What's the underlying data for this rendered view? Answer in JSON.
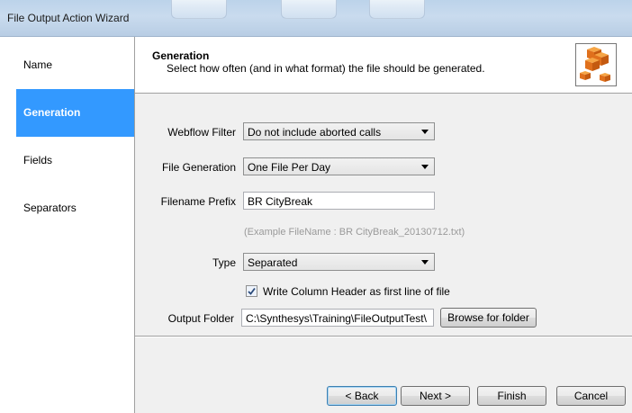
{
  "window": {
    "title": "File Output Action Wizard"
  },
  "sidebar": {
    "items": [
      {
        "label": "Name"
      },
      {
        "label": "Generation",
        "selected": true
      },
      {
        "label": "Fields"
      },
      {
        "label": "Separators"
      }
    ]
  },
  "header": {
    "title": "Generation",
    "subtitle": "Select how often (and in what format) the file should be generated.",
    "icon": "cubes-icon"
  },
  "form": {
    "webflow_filter": {
      "label": "Webflow Filter",
      "value": "Do not include aborted calls"
    },
    "file_generation": {
      "label": "File Generation",
      "value": "One File Per Day"
    },
    "filename_prefix": {
      "label": "Filename Prefix",
      "value": "BR CityBreak"
    },
    "example": "(Example FileName : BR CityBreak_20130712.txt)",
    "type": {
      "label": "Type",
      "value": "Separated"
    },
    "write_header": {
      "label": "Write Column Header as first line of file",
      "checked": true
    },
    "output_folder": {
      "label": "Output Folder",
      "value": "C:\\Synthesys\\Training\\FileOutputTest\\"
    },
    "browse_label": "Browse for folder"
  },
  "buttons": {
    "back": "< Back",
    "next": "Next >",
    "finish": "Finish",
    "cancel": "Cancel"
  },
  "colors": {
    "selection": "#3399ff",
    "titlebar": "#c9dbee"
  }
}
